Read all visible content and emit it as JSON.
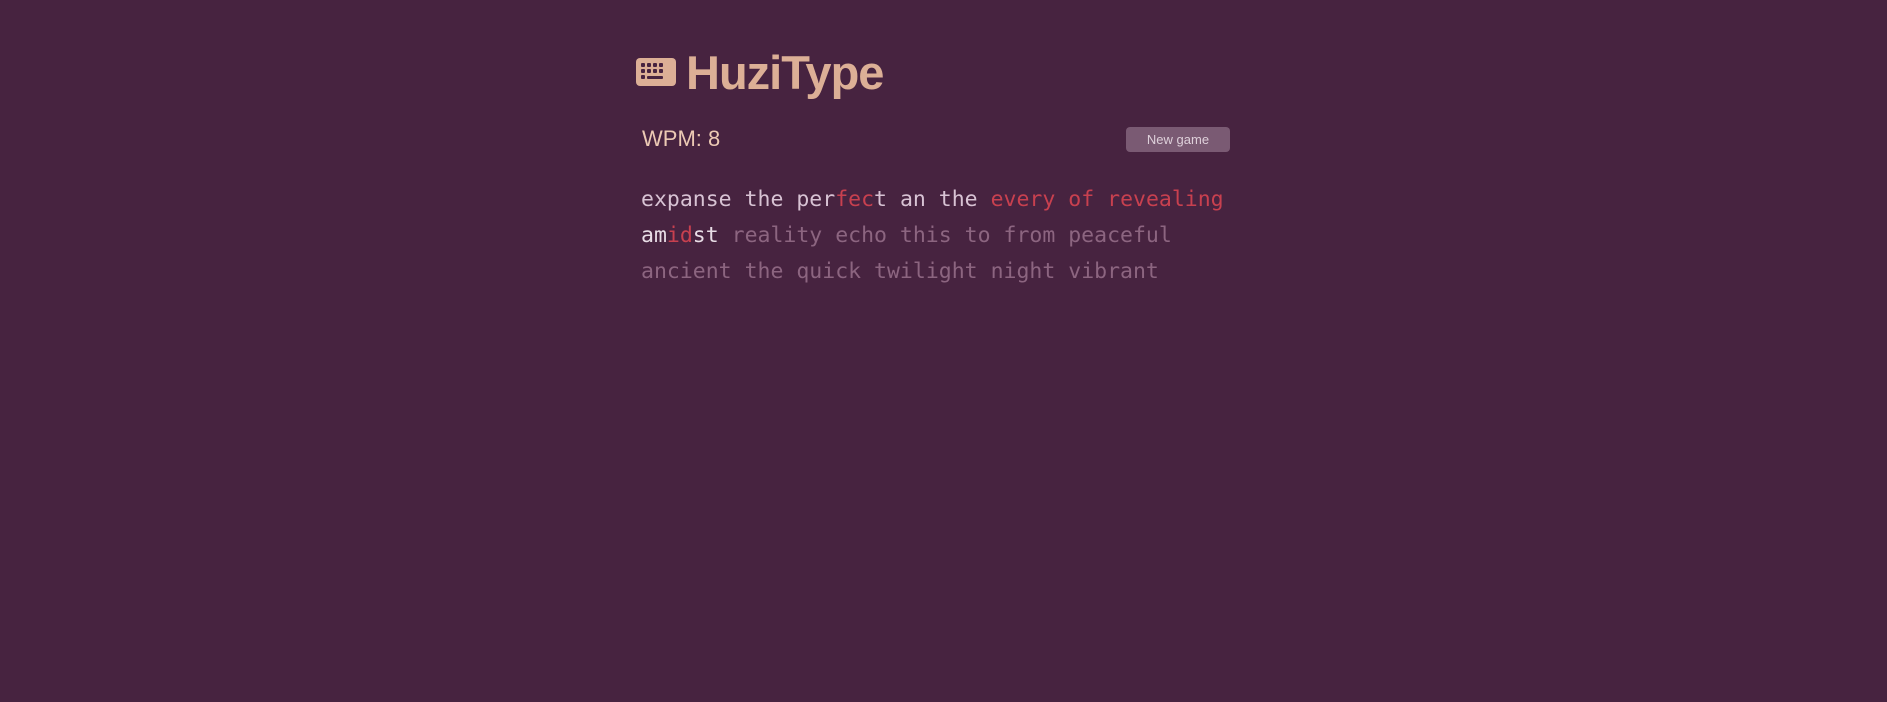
{
  "app": {
    "title": "HuziType",
    "logo_icon": "keyboard-icon",
    "colors": {
      "background": "#472340",
      "brand": "#dcaf96",
      "correct": "#d8c3d4",
      "incorrect": "#c8404f",
      "pending": "#8c6580"
    }
  },
  "stats": {
    "wpm_label": "WPM: 8"
  },
  "controls": {
    "new_game_label": "New game"
  },
  "typing": {
    "lines": [
      [
        {
          "parts": [
            {
              "t": "expanse",
              "s": "correct"
            }
          ]
        },
        {
          "parts": [
            {
              "t": "the",
              "s": "correct"
            }
          ]
        },
        {
          "parts": [
            {
              "t": "per",
              "s": "correct"
            },
            {
              "t": "fec",
              "s": "incorrect"
            },
            {
              "t": "t",
              "s": "correct"
            }
          ]
        },
        {
          "parts": [
            {
              "t": "an",
              "s": "correct"
            }
          ]
        },
        {
          "parts": [
            {
              "t": "the",
              "s": "correct"
            }
          ]
        },
        {
          "parts": [
            {
              "t": "every",
              "s": "incorrect"
            }
          ]
        },
        {
          "parts": [
            {
              "t": "of",
              "s": "incorrect"
            }
          ]
        },
        {
          "parts": [
            {
              "t": "revealing",
              "s": "incorrect"
            }
          ]
        }
      ],
      [
        {
          "parts": [
            {
              "t": "am",
              "s": "bright"
            },
            {
              "t": "id",
              "s": "incorrect"
            },
            {
              "t": "st",
              "s": "bright"
            }
          ]
        },
        {
          "parts": [
            {
              "t": "reality",
              "s": "pending"
            }
          ]
        },
        {
          "parts": [
            {
              "t": "echo",
              "s": "pending"
            }
          ]
        },
        {
          "parts": [
            {
              "t": "this",
              "s": "pending"
            }
          ]
        },
        {
          "parts": [
            {
              "t": "to",
              "s": "pending"
            }
          ]
        },
        {
          "parts": [
            {
              "t": "from",
              "s": "pending"
            }
          ]
        },
        {
          "parts": [
            {
              "t": "peaceful",
              "s": "pending"
            }
          ]
        }
      ],
      [
        {
          "parts": [
            {
              "t": "ancient",
              "s": "pending"
            }
          ]
        },
        {
          "parts": [
            {
              "t": "the",
              "s": "pending"
            }
          ]
        },
        {
          "parts": [
            {
              "t": "quick",
              "s": "pending"
            }
          ]
        },
        {
          "parts": [
            {
              "t": "twilight",
              "s": "pending"
            }
          ]
        },
        {
          "parts": [
            {
              "t": "night",
              "s": "pending"
            }
          ]
        },
        {
          "parts": [
            {
              "t": "vibrant",
              "s": "pending"
            }
          ]
        }
      ]
    ]
  }
}
